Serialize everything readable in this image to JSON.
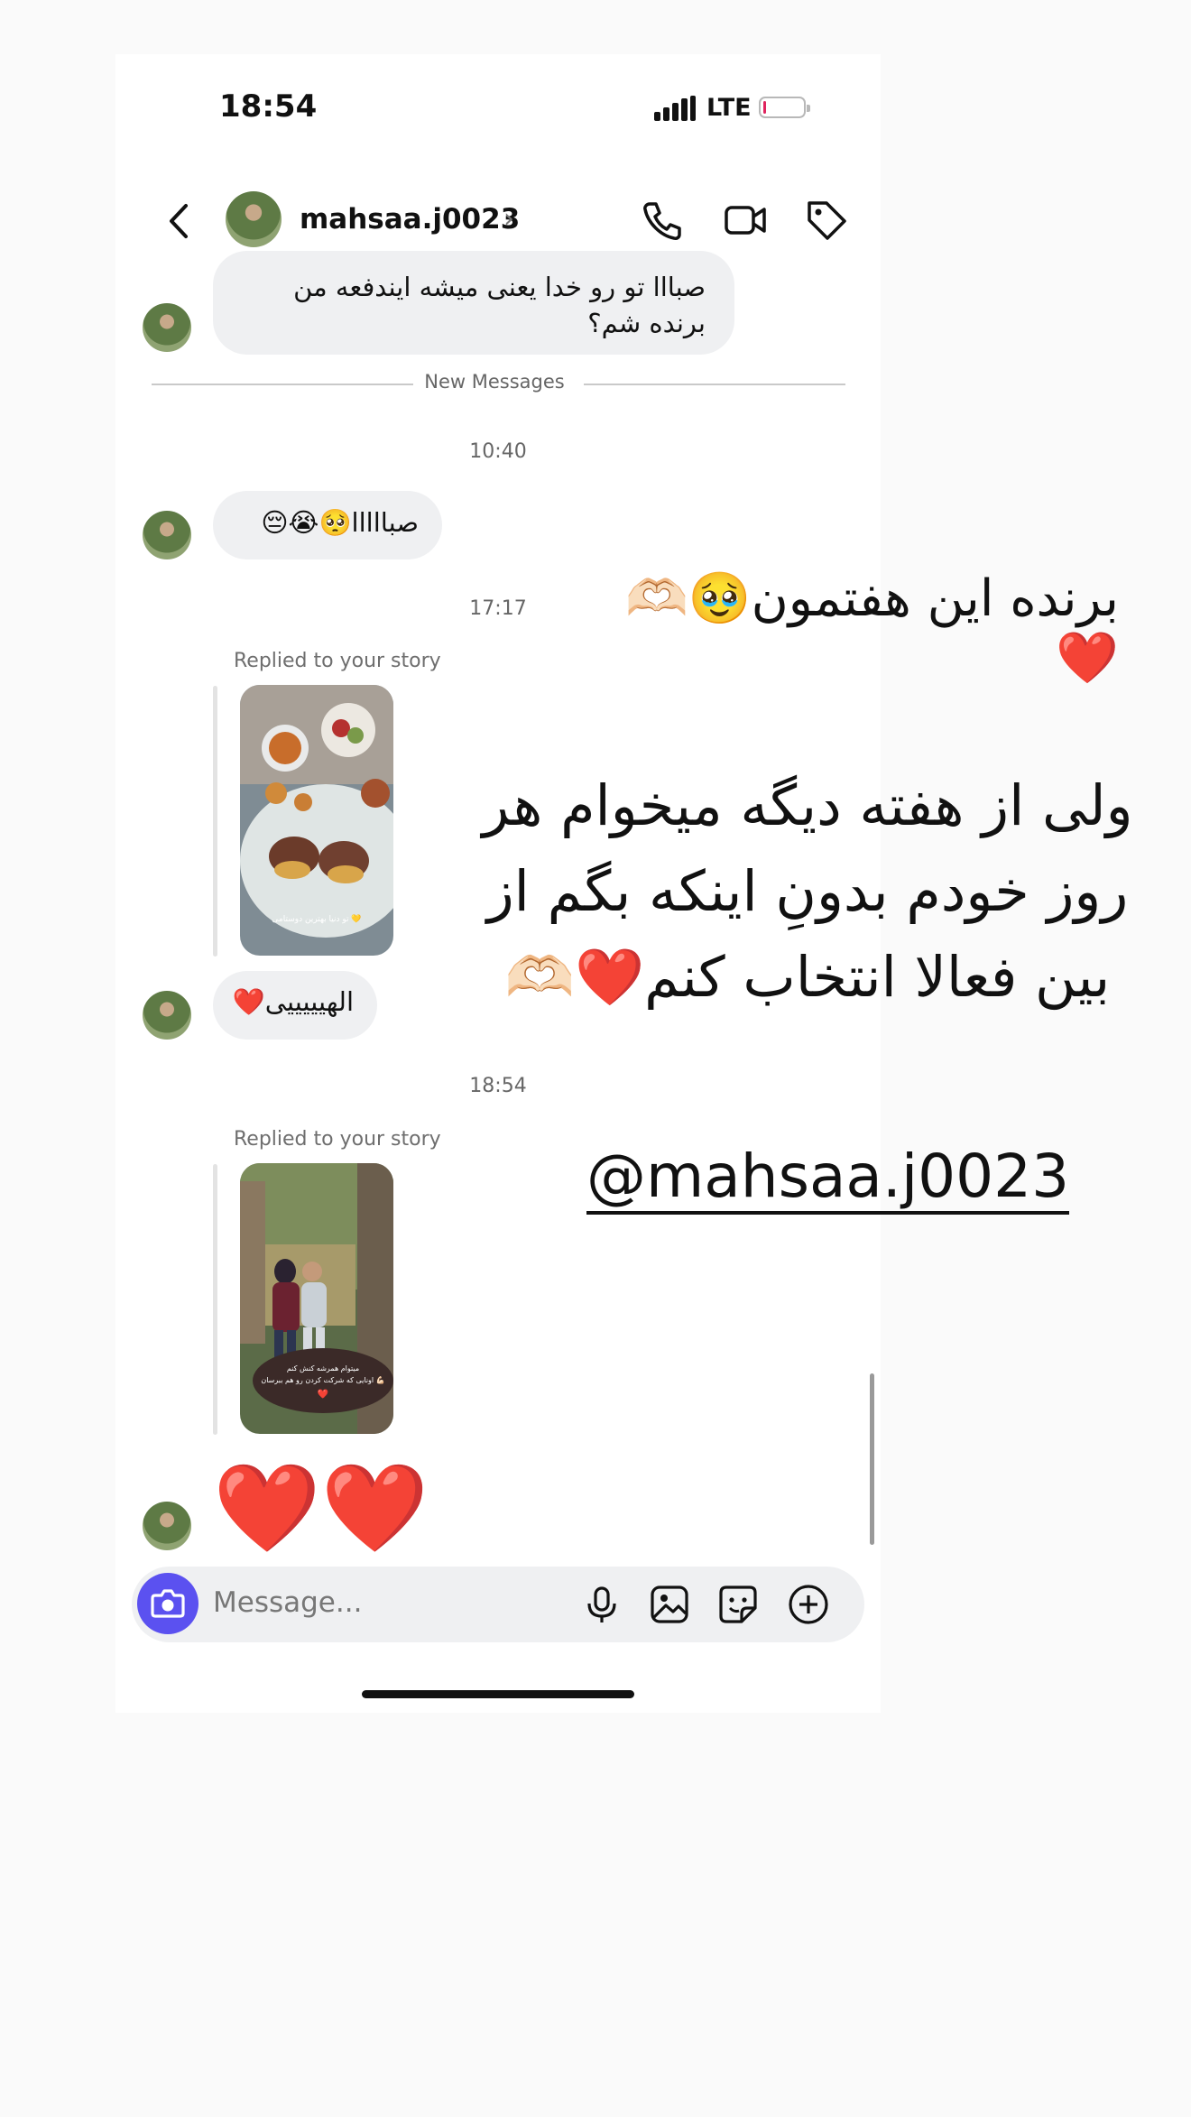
{
  "status": {
    "time": "18:54",
    "network": "LTE",
    "battery_level": 0.08
  },
  "header": {
    "username": "mahsaa.j0023",
    "chevron": "›"
  },
  "messages": {
    "first_text": "صبااا تو رو خدا یعنی میشه ایندفعه من برنده شم؟",
    "new_messages_label": "New Messages",
    "time_1": "10:40",
    "second_text": "صبااااا🥺😭😔",
    "time_2": "17:17",
    "replied_label_1": "Replied to your story",
    "story_1_caption": "تو دنیا بهترین دوستامی 💛",
    "third_text": "الهیییییی❤️",
    "time_3": "18:54",
    "replied_label_2": "Replied to your story",
    "story_2_caption_line1": "میتوام همرشه کنش کنم",
    "story_2_caption_line2": "اونایی که شرکت کردن رو هم ببرسان 💪🏻",
    "story_2_heart": "❤️",
    "hearts": "❤️❤️"
  },
  "composer": {
    "placeholder": "Message..."
  },
  "overlay": {
    "line1": "برنده این هفتمون🥹🫶🏻❤️",
    "line2a": "ولی از هفته دیگه میخوام هر",
    "line2b": "روز خودم بدونِ اینکه بگم از",
    "line2c": "بین فعالا انتخاب کنم❤️🫶🏻",
    "handle": "@mahsaa.j0023"
  },
  "colors": {
    "accent": "#5b51f0",
    "bubble": "#eff0f2",
    "battery_low": "#e0245e"
  },
  "icons": [
    "back-arrow-icon",
    "phone-icon",
    "video-icon",
    "tag-icon",
    "camera-icon",
    "microphone-icon",
    "gallery-icon",
    "sticker-icon",
    "plus-icon"
  ]
}
